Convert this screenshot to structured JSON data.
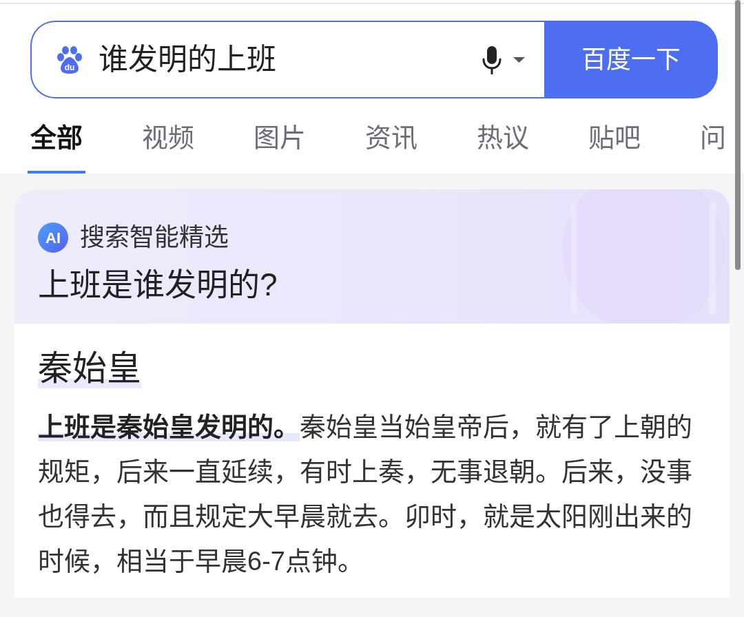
{
  "search": {
    "logo_text": "du",
    "value": "谁发明的上班",
    "button": "百度一下"
  },
  "tabs": [
    {
      "label": "全部",
      "selected": true
    },
    {
      "label": "视频",
      "selected": false
    },
    {
      "label": "图片",
      "selected": false
    },
    {
      "label": "资讯",
      "selected": false
    },
    {
      "label": "热议",
      "selected": false
    },
    {
      "label": "贴吧",
      "selected": false
    },
    {
      "label": "问",
      "selected": false
    }
  ],
  "ai_card": {
    "badge": "AI",
    "source": "搜索智能精选",
    "question": "上班是谁发明的?",
    "answer_title": "秦始皇",
    "answer_text": "**上班是秦始皇发明的。**秦始皇当始皇帝后，就有了上朝的规矩，后来一直延续，有时上奏，无事退朝。后来，没事也得去，而且规定大早晨就去。卯时，就是太阳刚出来的时候，相当于早晨6-7点钟。"
  }
}
